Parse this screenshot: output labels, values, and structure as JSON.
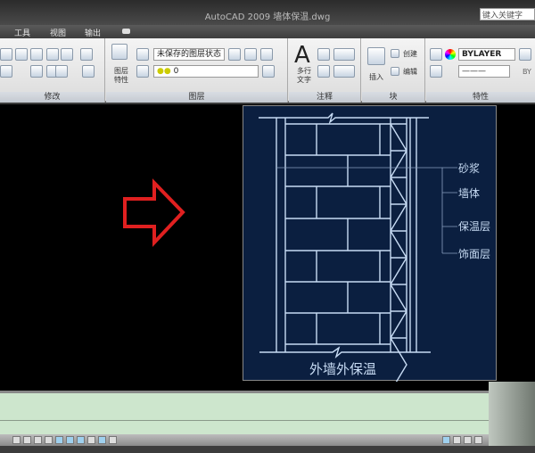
{
  "window": {
    "title": "AutoCAD 2009  墙体保温.dwg",
    "search_placeholder": "键入关键字"
  },
  "menu": [
    "工具",
    "视图",
    "输出"
  ],
  "ribbon": {
    "panels": [
      {
        "label": "修改"
      },
      {
        "label": "图层",
        "big_button": "图层\n特性",
        "layer_state": "未保存的图层状态",
        "current_layer": "0"
      },
      {
        "label": "注释",
        "big_button": "多行\n文字"
      },
      {
        "label": "块",
        "insert": "插入",
        "create": "创建",
        "edit": "编辑"
      },
      {
        "label": "特性",
        "color": "BYLAYER",
        "lineweight": "BY"
      }
    ]
  },
  "drawing": {
    "callouts": [
      "砂浆",
      "墙体",
      "保温层",
      "饰面层"
    ],
    "caption": "外墙外保温",
    "colors": {
      "bg": "#0b1f40",
      "line": "#c8dcf4",
      "arrow": "#e02020"
    }
  }
}
